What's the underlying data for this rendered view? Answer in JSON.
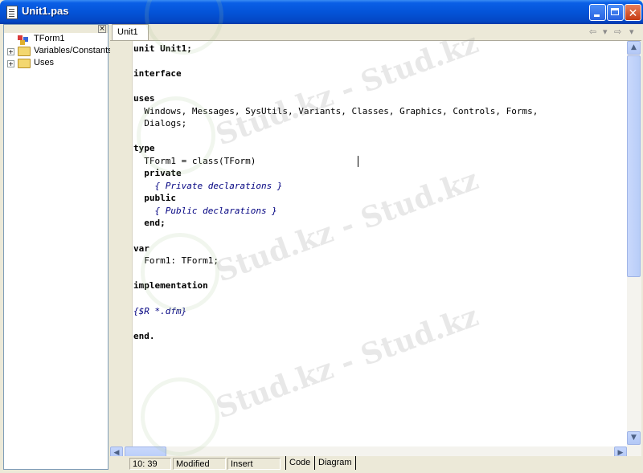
{
  "window": {
    "title": "Unit1.pas"
  },
  "title_buttons": {
    "close": "✕"
  },
  "explorer": {
    "items": [
      {
        "label": "TForm1"
      },
      {
        "label": "Variables/Constants"
      },
      {
        "label": "Uses"
      }
    ]
  },
  "editor": {
    "tab": "Unit1",
    "code_lines": [
      "unit Unit1;",
      "",
      "interface",
      "",
      "uses",
      "  Windows, Messages, SysUtils, Variants, Classes, Graphics, Controls, Forms,",
      "  Dialogs;",
      "",
      "type",
      "  TForm1 = class(TForm)",
      "  private",
      "    { Private declarations }",
      "  public",
      "    { Public declarations }",
      "  end;",
      "",
      "var",
      "  Form1: TForm1;",
      "",
      "implementation",
      "",
      "{$R *.dfm}",
      "",
      "end."
    ]
  },
  "statusbar": {
    "position": "10: 39",
    "modified": "Modified",
    "mode": "Insert",
    "tabs": [
      "Code",
      "Diagram"
    ]
  },
  "watermark": {
    "text": "Stud.kz - Stud.kz"
  },
  "colors": {
    "titlebar": "#0454d8",
    "comment": "#000080"
  }
}
